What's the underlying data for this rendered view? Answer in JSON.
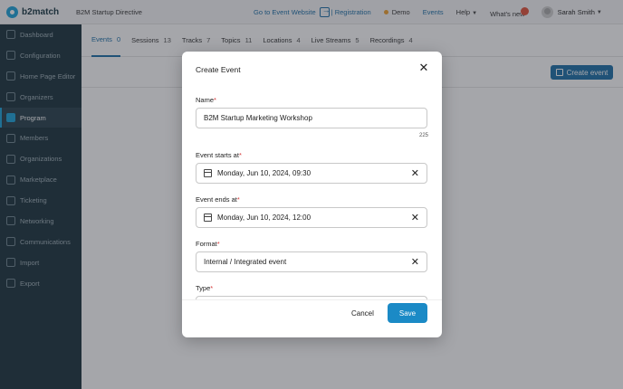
{
  "header": {
    "brand": "b2match",
    "event_name": "B2M Startup Directive",
    "go_to_event": "Go to Event Website",
    "registration": "| Registration",
    "demo": "Demo",
    "events": "Events",
    "help": "Help",
    "whats_new": "What's new",
    "whats_new_badge": "",
    "user_name": "Sarah Smith"
  },
  "sidebar": {
    "items": [
      {
        "label": "Dashboard"
      },
      {
        "label": "Configuration"
      },
      {
        "label": "Home Page Editor"
      },
      {
        "label": "Organizers"
      },
      {
        "label": "Program"
      },
      {
        "label": "Members"
      },
      {
        "label": "Organizations"
      },
      {
        "label": "Marketplace"
      },
      {
        "label": "Ticketing"
      },
      {
        "label": "Networking"
      },
      {
        "label": "Communications"
      },
      {
        "label": "Import"
      },
      {
        "label": "Export"
      }
    ]
  },
  "tabs": [
    {
      "label": "Events",
      "count": "0"
    },
    {
      "label": "Sessions",
      "count": "13"
    },
    {
      "label": "Tracks",
      "count": "7"
    },
    {
      "label": "Topics",
      "count": "11"
    },
    {
      "label": "Locations",
      "count": "4"
    },
    {
      "label": "Live Streams",
      "count": "5"
    },
    {
      "label": "Recordings",
      "count": "4"
    }
  ],
  "create_event_button": "Create event",
  "modal": {
    "title": "Create Event",
    "name_label": "Name",
    "name_value": "B2M Startup Marketing Workshop",
    "name_char_count": "225",
    "starts_label": "Event starts at",
    "starts_value": "Monday, Jun 10, 2024, 09:30",
    "ends_label": "Event ends at",
    "ends_value": "Monday, Jun 10, 2024, 12:00",
    "format_label": "Format",
    "format_value": "Internal / Integrated event",
    "type_label": "Type",
    "required_mark": "*",
    "cancel": "Cancel",
    "save": "Save"
  }
}
